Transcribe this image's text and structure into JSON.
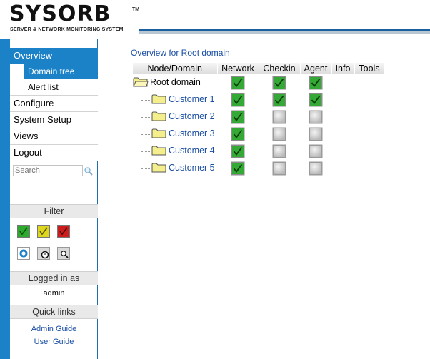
{
  "header": {
    "logo_text": "SYSORB",
    "trademark": "TM",
    "tagline": "SERVER & NETWORK MONITORING SYSTEM"
  },
  "sidebar": {
    "nav": [
      {
        "label": "Overview",
        "active": true
      },
      {
        "label": "Domain tree",
        "active": true,
        "sub": true
      },
      {
        "label": "Alert list",
        "active": false,
        "sub": true
      },
      {
        "label": "Configure",
        "active": false
      },
      {
        "label": "System Setup",
        "active": false
      },
      {
        "label": "Views",
        "active": false
      },
      {
        "label": "Logout",
        "active": false
      }
    ],
    "search": {
      "placeholder": "Search",
      "icon": "magnifier-icon"
    },
    "filter": {
      "title": "Filter",
      "buttons": [
        {
          "name": "ok-filter",
          "color": "#2eaa2e"
        },
        {
          "name": "warning-filter",
          "color": "#d9d21a"
        },
        {
          "name": "critical-filter",
          "color": "#cc1c1c"
        },
        {
          "name": "status-filter-icon",
          "color": "#1c82c8"
        },
        {
          "name": "clock-filter-icon",
          "color": "#777777"
        },
        {
          "name": "magnify-filter-icon",
          "color": "#777777"
        }
      ]
    },
    "logged_in": {
      "title": "Logged in as",
      "user": "admin"
    },
    "quick_links": {
      "title": "Quick links",
      "links": [
        "Admin Guide",
        "User Guide"
      ]
    }
  },
  "main": {
    "title": "Overview for Root domain",
    "columns": [
      "Node/Domain",
      "Network",
      "Checkin",
      "Agent",
      "Info",
      "Tools"
    ],
    "rows": [
      {
        "name": "Root domain",
        "child": false,
        "network": "ok",
        "checkin": "ok",
        "agent": "ok"
      },
      {
        "name": "Customer 1",
        "child": true,
        "network": "ok",
        "checkin": "ok",
        "agent": "ok"
      },
      {
        "name": "Customer 2",
        "child": true,
        "network": "ok",
        "checkin": "none",
        "agent": "none"
      },
      {
        "name": "Customer 3",
        "child": true,
        "network": "ok",
        "checkin": "none",
        "agent": "none"
      },
      {
        "name": "Customer 4",
        "child": true,
        "network": "ok",
        "checkin": "none",
        "agent": "none"
      },
      {
        "name": "Customer 5",
        "child": true,
        "network": "ok",
        "checkin": "none",
        "agent": "none"
      }
    ]
  },
  "colors": {
    "accent": "#1c82c8",
    "link": "#1a4ea3",
    "header_bar": "#1a5f9e",
    "ok": "#2eaa2e",
    "status_none": "#cfcfcf",
    "folder": "#f4ee8c"
  }
}
